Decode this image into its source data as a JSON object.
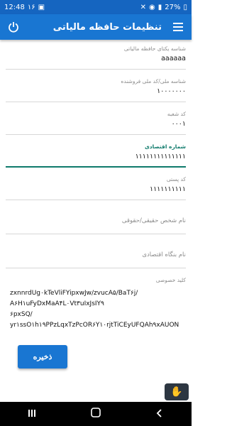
{
  "status_bar": {
    "time": "12:48",
    "notification_count": "۱۶",
    "battery": "27%"
  },
  "app_bar": {
    "title": "تنظیمات حافظه مالیاتی"
  },
  "fields": [
    {
      "label": "شناسه یکتای حافظه مالیاتی",
      "value": "aaaaaa"
    },
    {
      "label": "شناسه ملی/کد ملی فروشنده",
      "value": "۱۰۰۰۰۰۰۰"
    },
    {
      "label": "کد شعبه",
      "value": "۰۰۰۱"
    },
    {
      "label": "شماره اقتصادی",
      "value": "۱۱۱۱۱۱۱۱۱۱۱۱۱۱"
    },
    {
      "label": "کد پستی",
      "value": "۱۱۱۱۱۱۱۱۱۱"
    }
  ],
  "placeholders": {
    "person_type": "نام شخص حقیقی/حقوقی",
    "company_name": "نام بنگاه اقتصادی"
  },
  "private_key": {
    "label": "کلید خصوصی",
    "lines": [
      "zxnnrdUg۰kTeVliFYipxwJw/zvucA۵/BaT۶j/",
      "A۶H۱uFyDxMaA۴L۰Vt۳uIxJsIY۹",
      "۶pxSQ/",
      "yr۱ssO۱h۱۹PPzLqxTzPcOR۶Y۱۰rjtTiCEyUFQAh۹xAUON"
    ]
  },
  "buttons": {
    "save": "ذخیره"
  },
  "colors": {
    "primary": "#1976d2",
    "status_bar": "#1565c0",
    "accent": "#0e7a6b"
  }
}
